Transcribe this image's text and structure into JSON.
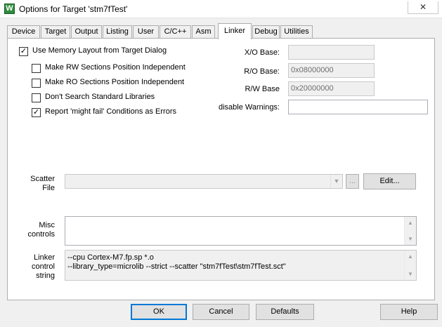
{
  "window": {
    "title": "Options for Target 'stm7fTest'",
    "icon_letter": "W",
    "close_glyph": "✕"
  },
  "tabs": [
    {
      "label": "Device"
    },
    {
      "label": "Target"
    },
    {
      "label": "Output"
    },
    {
      "label": "Listing"
    },
    {
      "label": "User"
    },
    {
      "label": "C/C++"
    },
    {
      "label": "Asm"
    },
    {
      "label": "Linker",
      "active": true
    },
    {
      "label": "Debug"
    },
    {
      "label": "Utilities"
    }
  ],
  "options": {
    "use_memory_layout": {
      "label": "Use Memory Layout from Target Dialog",
      "checked": true
    },
    "rw_independent": {
      "label": "Make RW Sections Position Independent",
      "checked": false
    },
    "ro_independent": {
      "label": "Make RO Sections Position Independent",
      "checked": false
    },
    "no_std_libs": {
      "label": "Don't Search Standard Libraries",
      "checked": false
    },
    "might_fail_errors": {
      "label": "Report 'might fail' Conditions as Errors",
      "checked": true
    }
  },
  "bases": {
    "xo_label": "X/O Base:",
    "xo_value": "",
    "ro_label": "R/O Base:",
    "ro_value": "0x08000000",
    "rw_label": "R/W Base",
    "rw_value": "0x20000000",
    "warnings_label": "disable Warnings:",
    "warnings_value": ""
  },
  "scatter": {
    "label_line1": "Scatter",
    "label_line2": "File",
    "value": "",
    "browse_label": "...",
    "edit_label": "Edit..."
  },
  "misc": {
    "label_line1": "Misc",
    "label_line2": "controls",
    "value": ""
  },
  "linker_control": {
    "label_line1": "Linker",
    "label_line2": "control",
    "label_line3": "string",
    "line1": "--cpu Cortex-M7.fp.sp *.o",
    "line2": "--library_type=microlib --strict --scatter \"stm7fTest\\stm7fTest.sct\""
  },
  "footer": {
    "ok": "OK",
    "cancel": "Cancel",
    "defaults": "Defaults",
    "help": "Help"
  },
  "icons": {
    "check": "✓",
    "combo_arrow": "▼",
    "scroll_up": "▲",
    "scroll_down": "▼"
  }
}
